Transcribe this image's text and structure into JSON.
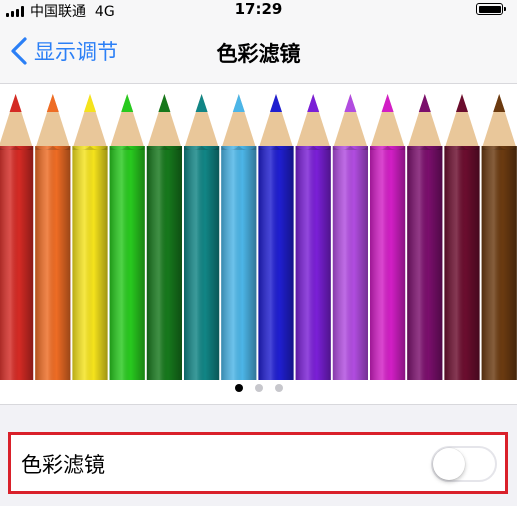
{
  "status_bar": {
    "carrier": "中国联通",
    "network": "4G",
    "time": "17:29",
    "battery_level": 1.0
  },
  "nav": {
    "back_label": "显示调节",
    "title": "色彩滤镜"
  },
  "image": {
    "pencil_colors": [
      "#d42a24",
      "#ee6c24",
      "#f5e31c",
      "#28c91e",
      "#16781c",
      "#118585",
      "#4cb5e7",
      "#1f1ed0",
      "#7a1fd6",
      "#b14ce0",
      "#d21ec5",
      "#7a0e6c",
      "#6b0d2e",
      "#6b3a10"
    ],
    "page_count": 3,
    "active_page": 1
  },
  "setting": {
    "label": "色彩滤镜",
    "enabled": false
  },
  "colors": {
    "accent": "#2b7ff6",
    "highlight_border": "#d9202a"
  }
}
